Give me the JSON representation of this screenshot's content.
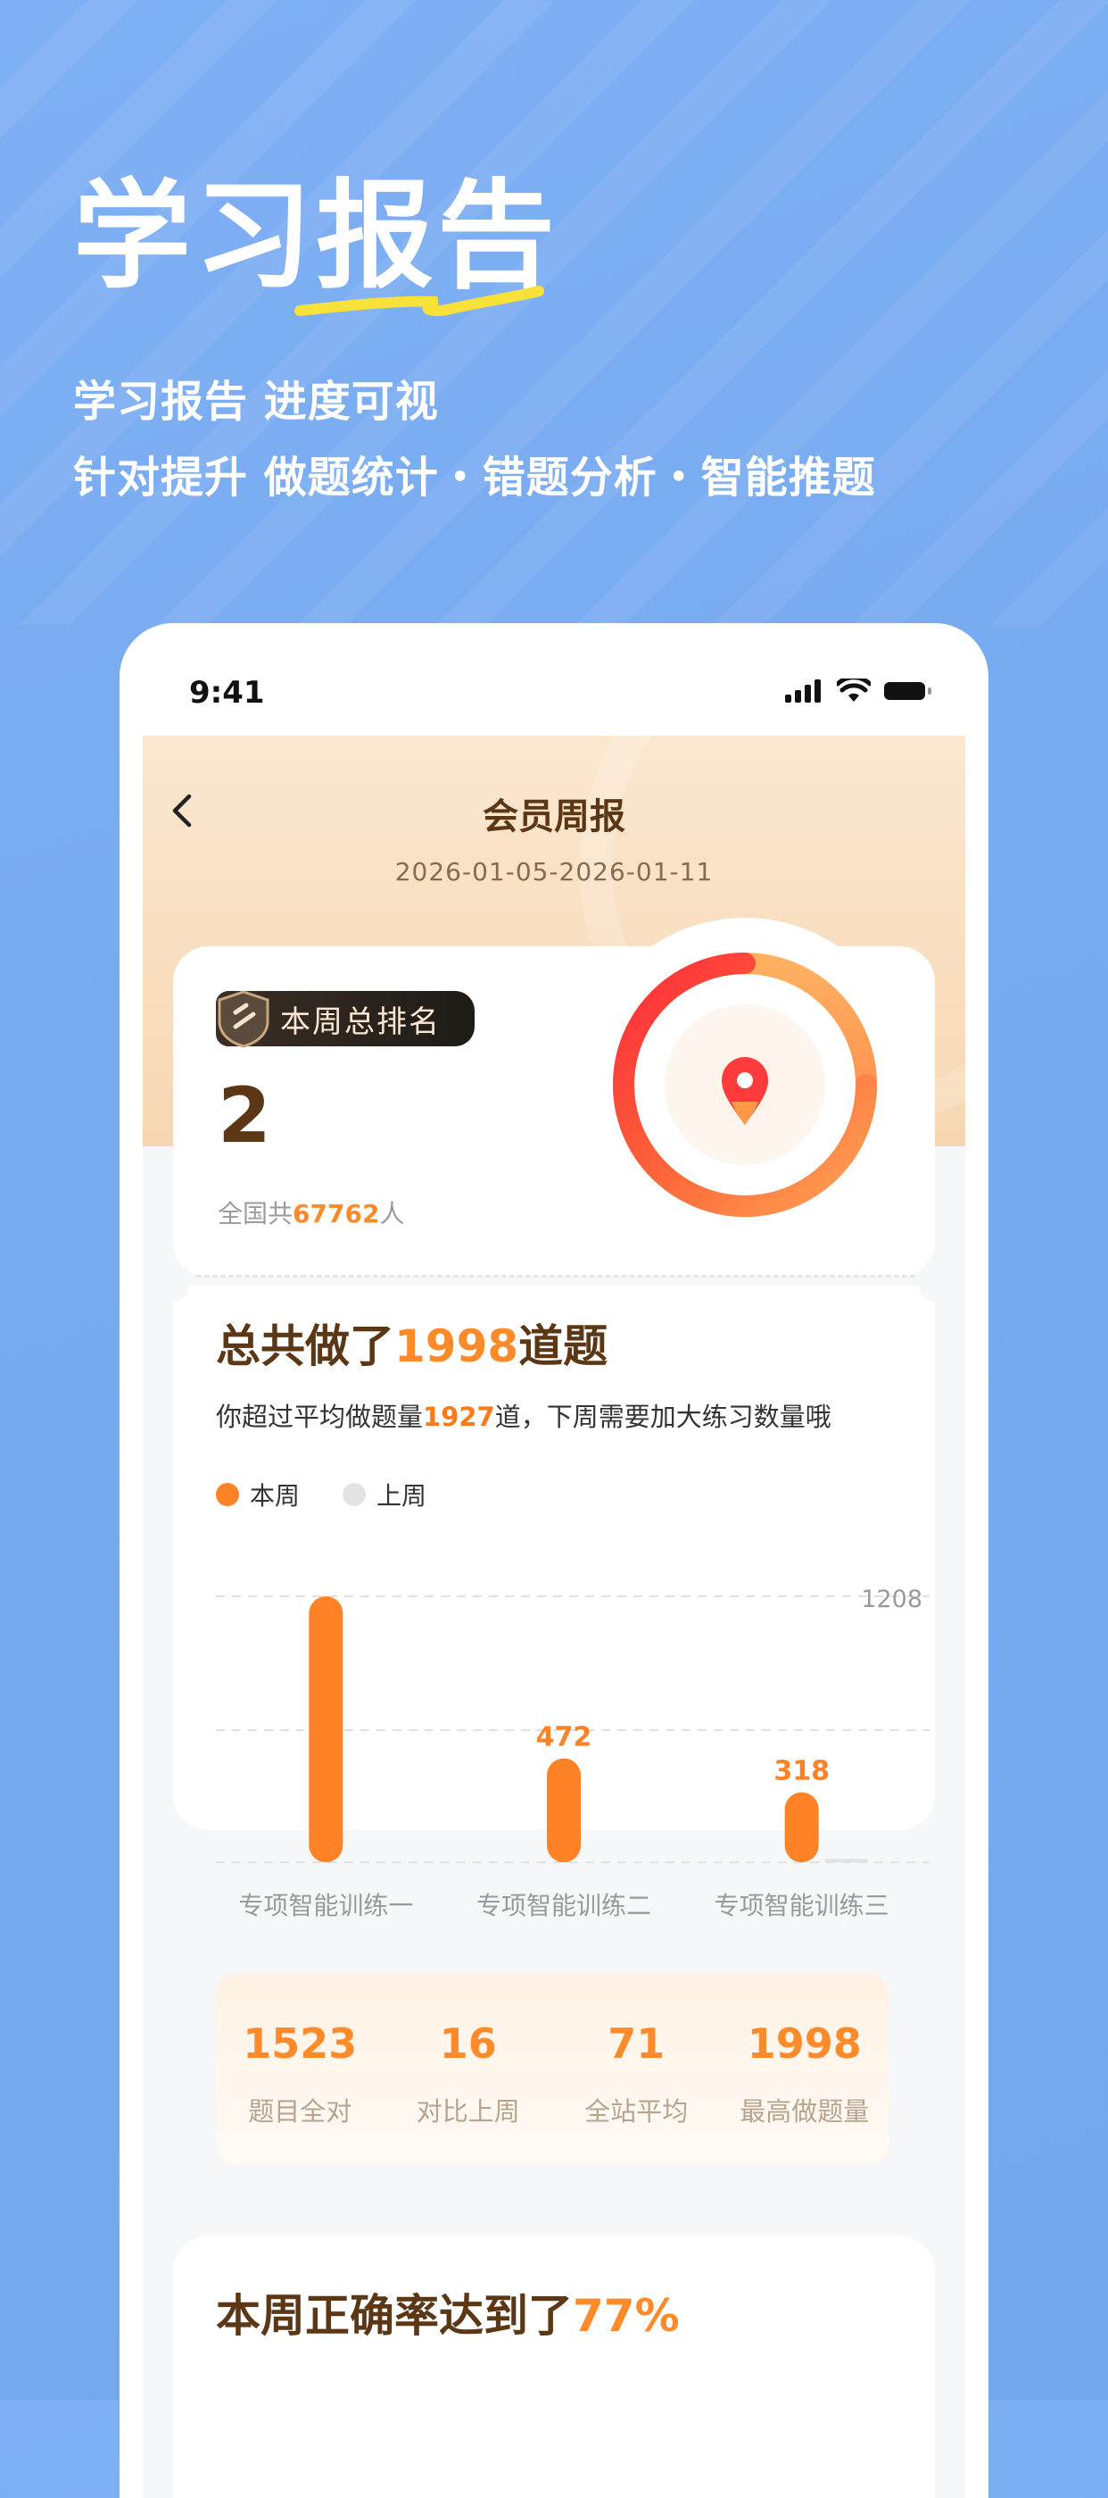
{
  "promo": {
    "headline": "学习报告",
    "subtitle_1": "学习报告 进度可视",
    "subtitle_2": "针对提升 做题统计・错题分析・智能推题"
  },
  "status_bar": {
    "time": "9:41",
    "icons": [
      "signal-icon",
      "wifi-icon",
      "battery-icon"
    ]
  },
  "nav": {
    "back_icon": "chevron-left-icon",
    "title": "会员周报",
    "date_range": "2026-01-05-2026-01-11"
  },
  "ranking": {
    "badge_label": "本周总排名",
    "rank": "2",
    "total_prefix": "全国共",
    "total_count": "67762",
    "total_suffix": "人",
    "ring_icon": "location-pin-icon",
    "colors": {
      "start": "#ff2a3a",
      "end": "#ffb061"
    }
  },
  "questions": {
    "title_prefix": "总共做了",
    "title_count": "1998",
    "title_suffix": "道题",
    "desc_prefix": "你超过平均做题量",
    "desc_count": "1927",
    "desc_suffix": "道，下周需要加大练习数量哦",
    "legend": [
      {
        "label": "本周",
        "color": "#ff8226"
      },
      {
        "label": "上周",
        "color": "#e3e3e3"
      }
    ]
  },
  "chart_data": {
    "type": "bar",
    "categories": [
      "专项智能训练一",
      "专项智能训练二",
      "专项智能训练三"
    ],
    "series": [
      {
        "name": "本周",
        "values": [
          1208,
          472,
          318
        ],
        "color": "#ff8226"
      },
      {
        "name": "上周",
        "values": [
          0,
          0,
          10
        ],
        "color": "#e3e3e3"
      }
    ],
    "data_labels": [
      "",
      "472",
      "318"
    ],
    "ylim": [
      0,
      1208
    ],
    "y_tick_label": "1208",
    "grid": true
  },
  "stats": [
    {
      "value": "1523",
      "label": "题目全对"
    },
    {
      "value": "16",
      "label": "对比上周"
    },
    {
      "value": "71",
      "label": "全站平均"
    },
    {
      "value": "1998",
      "label": "最高做题量"
    }
  ],
  "accuracy": {
    "title_prefix": "本周正确率达到了",
    "title_value": "77%"
  }
}
